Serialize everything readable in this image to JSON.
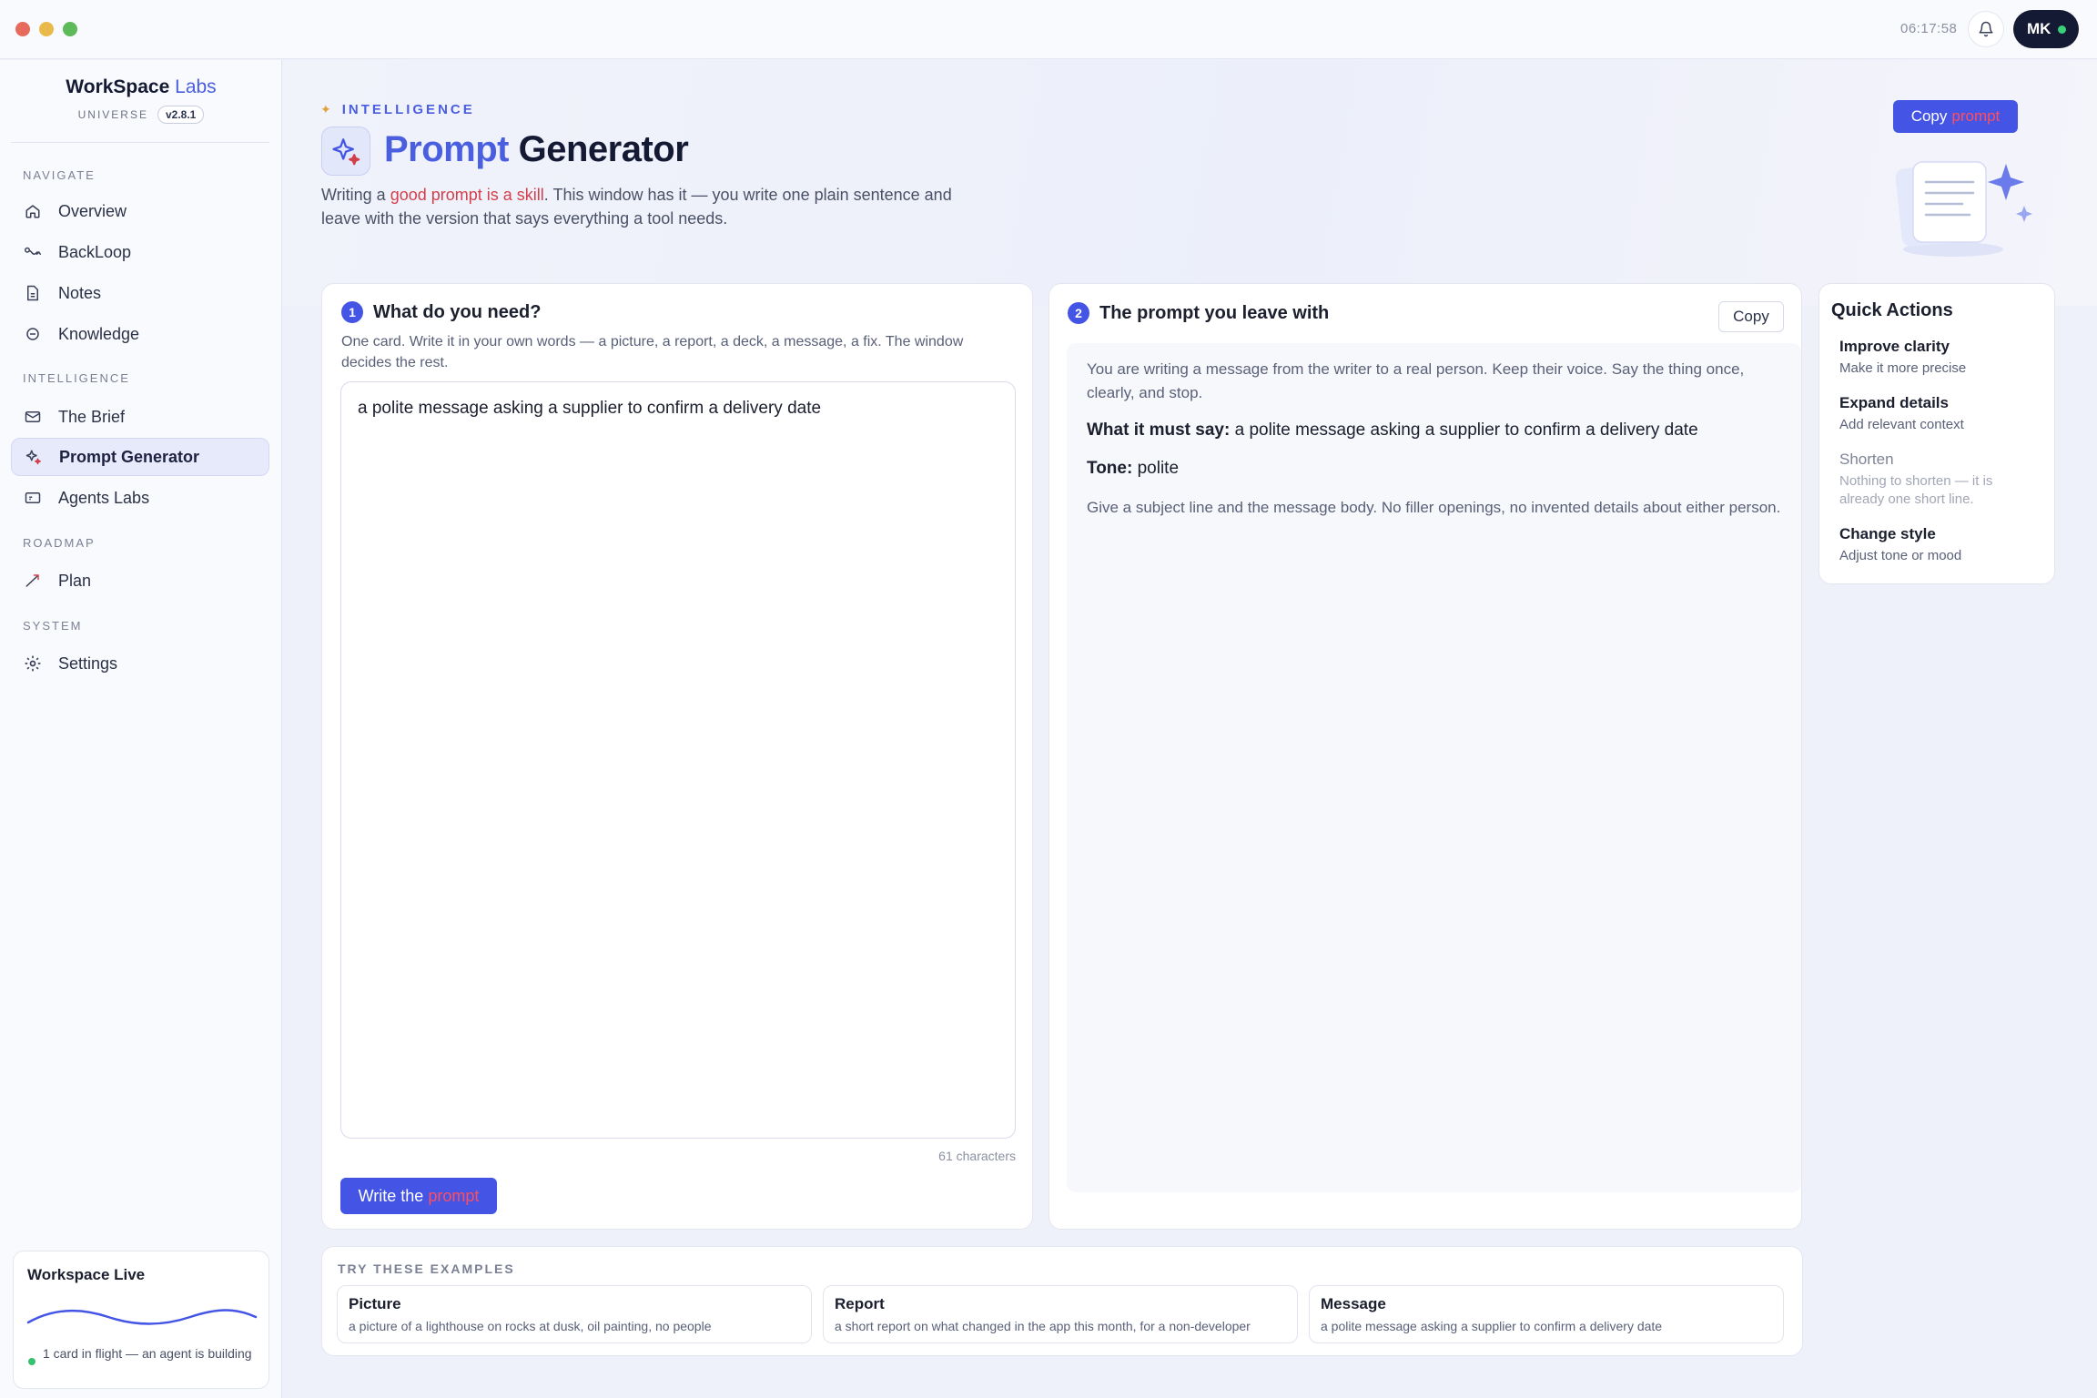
{
  "window": {
    "clock": "06:17:58",
    "user_initials": "MK"
  },
  "brand": {
    "name_part1": "WorkSpace",
    "name_part2": "Labs",
    "subtitle": "UNIVERSE",
    "version": "v2.8.1"
  },
  "sidebar": {
    "sections": {
      "navigate": "NAVIGATE",
      "intelligence": "INTELLIGENCE",
      "roadmap": "ROADMAP",
      "system": "SYSTEM"
    },
    "items": [
      {
        "label": "Overview",
        "icon": "home-icon"
      },
      {
        "label": "BackLoop",
        "icon": "loop-icon"
      },
      {
        "label": "Notes",
        "icon": "note-icon"
      },
      {
        "label": "Knowledge",
        "icon": "knowledge-icon"
      },
      {
        "label": "The Brief",
        "icon": "mail-icon"
      },
      {
        "label": "Prompt Generator",
        "icon": "sparkle-icon",
        "active": true
      },
      {
        "label": "Agents Labs",
        "icon": "agent-icon"
      },
      {
        "label": "Plan",
        "icon": "trend-icon"
      },
      {
        "label": "Settings",
        "icon": "gear-icon"
      }
    ],
    "live": {
      "title": "Workspace Live",
      "status": "1 card in flight — an agent is building"
    }
  },
  "header": {
    "eyebrow": "INTELLIGENCE",
    "title_part1": "Prompt",
    "title_part2": "Generator",
    "desc_pre": "Writing a ",
    "desc_highlight": "good prompt is a skill",
    "desc_post": ". This window has it — you write one plain sentence and leave with the version that says everything a tool needs.",
    "copy_button_part1": "Copy",
    "copy_button_part2": "prompt"
  },
  "input_card": {
    "step": "1",
    "title": "What do you need?",
    "desc": "One card. Write it in your own words — a picture, a report, a deck, a message, a fix. The window decides the rest.",
    "value": "a polite message asking a supplier to confirm a delivery date",
    "char_count": "61 characters",
    "button_part1": "Write the",
    "button_part2": "prompt"
  },
  "output_card": {
    "step": "2",
    "title": "The prompt you leave with",
    "copy_label": "Copy",
    "intro": "You are writing a message from the writer to a real person. Keep their voice. Say the thing once, clearly, and stop.",
    "must_say_label": "What it must say:",
    "must_say_value": "a polite message asking a supplier to confirm a delivery date",
    "tone_label": "Tone:",
    "tone_value": "polite",
    "closing": "Give a subject line and the message body. No filler openings, no invented details about either person."
  },
  "quick_actions": {
    "title": "Quick Actions",
    "items": [
      {
        "label": "Improve clarity",
        "hint": "Make it more precise"
      },
      {
        "label": "Expand details",
        "hint": "Add relevant context"
      },
      {
        "label": "Shorten",
        "hint": "Nothing to shorten — it is already one short line."
      },
      {
        "label": "Change style",
        "hint": "Adjust tone or mood"
      }
    ]
  },
  "examples": {
    "heading": "TRY THESE EXAMPLES",
    "items": [
      {
        "name": "Picture",
        "text": "a picture of a lighthouse on rocks at dusk, oil painting, no people"
      },
      {
        "name": "Report",
        "text": "a short report on what changed in the app this month, for a non-developer"
      },
      {
        "name": "Message",
        "text": "a polite message asking a supplier to confirm a delivery date"
      }
    ]
  },
  "colors": {
    "accent": "#4455e6",
    "highlight": "#d23f4a",
    "live_dot": "#35c270"
  }
}
